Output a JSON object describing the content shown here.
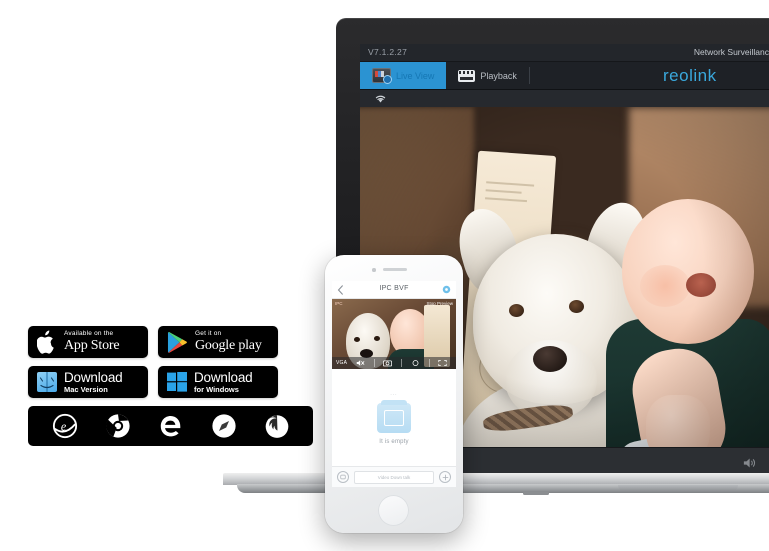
{
  "app": {
    "version": "V7.1.2.27",
    "product_name": "Network Surveillanc",
    "brand": "reolink",
    "tabs": [
      {
        "label": "Live View",
        "icon": "monitor-icon",
        "active": true
      },
      {
        "label": "Playback",
        "icon": "film-strip-icon",
        "active": false
      }
    ],
    "status_icons": [
      "wifi-icon"
    ],
    "toolbar": {
      "buttons": [
        {
          "name": "forward-arrow-button",
          "icon": "arrow-right-icon"
        },
        {
          "name": "snapshot-button",
          "icon": "camera-icon"
        },
        {
          "name": "record-button",
          "icon": "video-camera-icon"
        }
      ],
      "volume_icon": "speaker-icon"
    },
    "feed": {
      "subject": "dog-and-baby-live-view"
    }
  },
  "phone": {
    "nav": {
      "back_icon": "chevron-left-icon",
      "title": "IPC BVF",
      "settings_icon": "gear-icon"
    },
    "video": {
      "tag_left": "IPC",
      "tag_right": "Stop Preview",
      "quality": "VGA",
      "controls": [
        {
          "name": "mute-button",
          "icon": "mute-icon"
        },
        {
          "name": "snapshot-button",
          "icon": "camera-icon"
        },
        {
          "name": "record-button",
          "icon": "record-icon"
        },
        {
          "name": "fullscreen-button",
          "icon": "expand-icon"
        }
      ]
    },
    "body": {
      "dots": "...",
      "card_icon": "camera-box-icon",
      "empty_text": "It is empty"
    },
    "bottom": {
      "left_icon": "display-icon",
      "input_placeholder": "Video Down talk",
      "add_icon": "plus-icon"
    }
  },
  "badges": {
    "row1": [
      {
        "name": "app-store-badge",
        "small": "Available on the",
        "large": "App Store",
        "icon": "apple-icon"
      },
      {
        "name": "google-play-badge",
        "small": "Get it on",
        "large": "Google play",
        "icon": "google-play-icon"
      }
    ],
    "row2": [
      {
        "name": "download-mac-badge",
        "large": "Download",
        "sub": "Mac Version",
        "icon": "finder-icon"
      },
      {
        "name": "download-windows-badge",
        "large": "Download",
        "sub": "for Windows",
        "icon": "windows-icon"
      }
    ],
    "browsers": [
      {
        "name": "internet-explorer-icon",
        "label": "Internet Explorer"
      },
      {
        "name": "chrome-icon",
        "label": "Chrome"
      },
      {
        "name": "edge-icon",
        "label": "Edge"
      },
      {
        "name": "safari-icon",
        "label": "Safari"
      },
      {
        "name": "firefox-icon",
        "label": "Firefox"
      }
    ]
  },
  "colors": {
    "accent_blue": "#2b93d2",
    "brand_blue": "#3aa8dc",
    "badge_black": "#000000",
    "windows_blue": "#2aa3e8",
    "app_dark": "#23262b"
  }
}
